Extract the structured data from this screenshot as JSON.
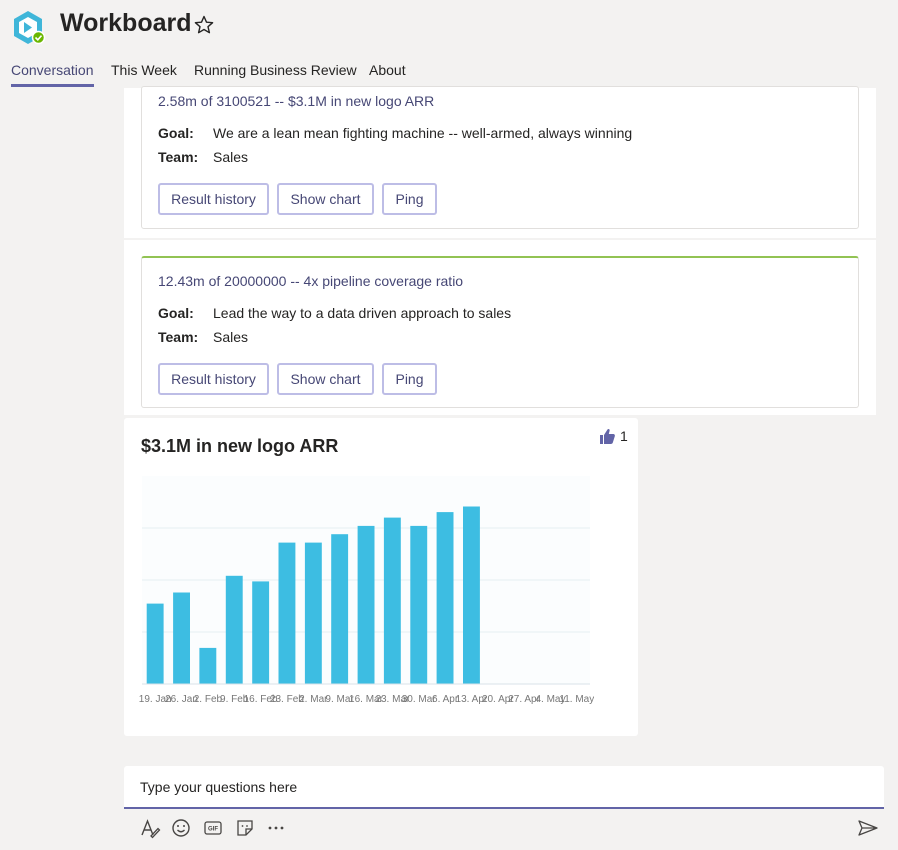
{
  "app": {
    "title": "Workboard",
    "brand_color": "#3fb6d9",
    "status_color": "#6bb700",
    "accent_color": "#6264a7"
  },
  "tabs": [
    {
      "label": "Conversation",
      "active": true
    },
    {
      "label": "This Week",
      "active": false
    },
    {
      "label": "Running Business Review",
      "active": false
    },
    {
      "label": "About",
      "active": false
    }
  ],
  "cards": [
    {
      "headline": "2.58m of 3100521 -- $3.1M in new logo ARR",
      "goal_label": "Goal:",
      "goal": "We are a lean mean fighting machine -- well-armed, always winning",
      "team_label": "Team:",
      "team": "Sales",
      "buttons": [
        "Result history",
        "Show chart",
        "Ping"
      ]
    },
    {
      "headline": "12.43m of 20000000 -- 4x pipeline coverage ratio",
      "goal_label": "Goal:",
      "goal": "Lead the way to a data driven approach to sales",
      "team_label": "Team:",
      "team": "Sales",
      "buttons": [
        "Result history",
        "Show chart",
        "Ping"
      ],
      "status_color": "#92c353"
    }
  ],
  "chart_card": {
    "title": "$3.1M in new logo ARR",
    "likes": "1"
  },
  "chart_data": {
    "type": "bar",
    "title": "$3.1M in new logo ARR",
    "categories": [
      "19. Jan",
      "26. Jan",
      "2. Feb",
      "9. Feb",
      "16. Feb",
      "23. Feb",
      "2. Mar",
      "9. Mar",
      "16. Mar",
      "23. Mar",
      "30. Mar",
      "6. Apr",
      "13. Apr",
      "20. Apr",
      "27. Apr",
      "4. May",
      "11. May"
    ],
    "values": [
      0.29,
      0.33,
      0.13,
      0.39,
      0.37,
      0.51,
      0.51,
      0.54,
      0.57,
      0.6,
      0.57,
      0.62,
      0.64,
      null,
      null,
      null,
      null
    ],
    "ylim": [
      0,
      0.75
    ],
    "grid": true,
    "bar_color": "#3dbde2"
  },
  "compose": {
    "placeholder": "Type your questions here"
  },
  "toolbar_icons": [
    "format-icon",
    "emoji-icon",
    "gif-icon",
    "sticker-icon",
    "more-options-icon"
  ],
  "send_icon": "send-icon"
}
